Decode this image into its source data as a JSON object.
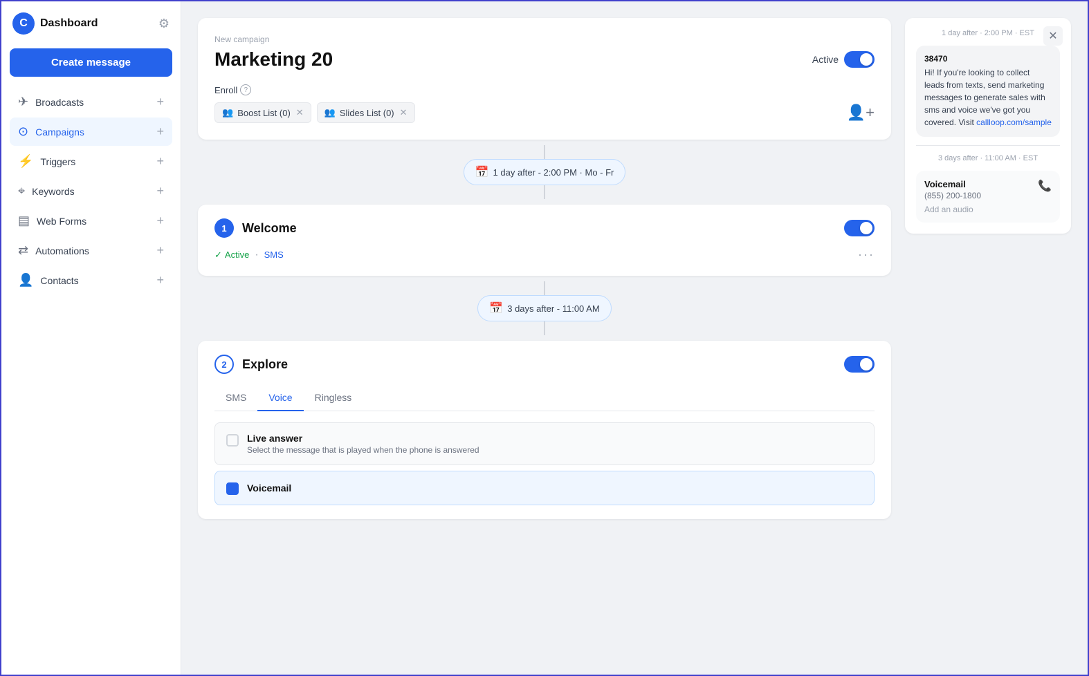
{
  "app": {
    "title": "Dashboard"
  },
  "sidebar": {
    "create_button": "Create message",
    "items": [
      {
        "id": "broadcasts",
        "label": "Broadcasts",
        "icon": "✈"
      },
      {
        "id": "campaigns",
        "label": "Campaigns",
        "icon": "⊙",
        "active": true
      },
      {
        "id": "triggers",
        "label": "Triggers",
        "icon": "⚡"
      },
      {
        "id": "keywords",
        "label": "Keywords",
        "icon": "⌖"
      },
      {
        "id": "web-forms",
        "label": "Web Forms",
        "icon": "▤"
      },
      {
        "id": "automations",
        "label": "Automations",
        "icon": "⇄"
      },
      {
        "id": "contacts",
        "label": "Contacts",
        "icon": "👤"
      }
    ]
  },
  "campaign": {
    "label": "New campaign",
    "title": "Marketing 20",
    "status": "Active",
    "is_active": true,
    "enroll_label": "Enroll",
    "tags": [
      {
        "label": "Boost List (0)"
      },
      {
        "label": "Slides List (0)"
      }
    ]
  },
  "schedule1": {
    "label": "1 day after - 2:00 PM  ·  Mo - Fr"
  },
  "step1": {
    "number": "1",
    "name": "Welcome",
    "status": "Active",
    "type": "SMS",
    "is_active": true
  },
  "schedule2": {
    "label": "3 days after - 11:00 AM"
  },
  "step2": {
    "number": "2",
    "name": "Explore",
    "is_active": true,
    "tabs": [
      "SMS",
      "Voice",
      "Ringless"
    ],
    "active_tab": "Voice",
    "live_answer": {
      "label": "Live answer",
      "description": "Select the message that is played when the phone is answered"
    },
    "voicemail": {
      "label": "Voicemail"
    }
  },
  "right_panel": {
    "timestamp1": "1 day after · 2:00 PM  ·  EST",
    "from": "38470",
    "message": "Hi! If you're looking to collect leads from texts, send marketing messages to generate sales with sms and voice we've got you covered. Visit callloop.com/sample",
    "link": "callloop.com/sample",
    "timestamp2": "3 days after · 11:00 AM  ·  EST",
    "voicemail_title": "Voicemail",
    "voicemail_phone": "(855) 200-1800",
    "voicemail_audio": "Add an audio"
  }
}
